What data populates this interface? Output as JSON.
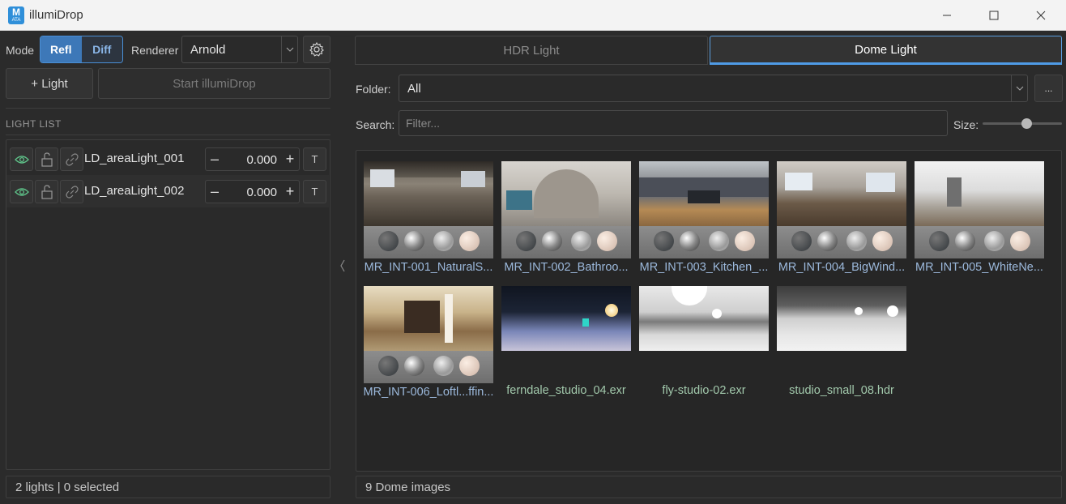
{
  "window": {
    "title": "illumiDrop",
    "icon_text": "M",
    "icon_subtext": "ATA"
  },
  "toolbar": {
    "mode_label": "Mode",
    "mode_options": [
      "Refl",
      "Diff"
    ],
    "mode_selected": "Refl",
    "renderer_label": "Renderer",
    "renderer_value": "Arnold",
    "add_light_label": "+  Light",
    "start_label": "Start illumiDrop"
  },
  "light_list": {
    "header": "LIGHT LIST",
    "items": [
      {
        "name": "LD_areaLight_001",
        "value": "0.000",
        "t_label": "T"
      },
      {
        "name": "LD_areaLight_002",
        "value": "0.000",
        "t_label": "T"
      }
    ],
    "status": "2 lights | 0 selected"
  },
  "tabs": [
    {
      "label": "HDR Light",
      "active": false
    },
    {
      "label": "Dome Light",
      "active": true
    }
  ],
  "browser": {
    "folder_label": "Folder:",
    "folder_value": "All",
    "browse_label": "...",
    "search_label": "Search:",
    "search_placeholder": "Filter...",
    "size_label": "Size:",
    "size_value": 0.55,
    "status": "9 Dome images",
    "items": [
      {
        "caption": "MR_INT-001_NaturalS...",
        "kind": "preview",
        "scene": "office"
      },
      {
        "caption": "MR_INT-002_Bathroo...",
        "kind": "preview",
        "scene": "bathroom"
      },
      {
        "caption": "MR_INT-003_Kitchen_...",
        "kind": "preview",
        "scene": "kitchen"
      },
      {
        "caption": "MR_INT-004_BigWind...",
        "kind": "preview",
        "scene": "room"
      },
      {
        "caption": "MR_INT-005_WhiteNe...",
        "kind": "preview",
        "scene": "white"
      },
      {
        "caption": "MR_INT-006_Loftl...ffin...",
        "kind": "preview",
        "scene": "loft"
      },
      {
        "caption": "ferndale_studio_04.exr",
        "kind": "hdr",
        "scene": "dark-studio"
      },
      {
        "caption": "fly-studio-02.exr",
        "kind": "hdr",
        "scene": "grey-studio"
      },
      {
        "caption": "studio_small_08.hdr",
        "kind": "hdr",
        "scene": "small-studio"
      }
    ]
  },
  "colors": {
    "accent": "#3d78b8",
    "tab_underline": "#4f9be6",
    "mr_caption": "#9cb9dc",
    "hdr_caption": "#a2c9ac",
    "eye_icon": "#5fc48a"
  }
}
